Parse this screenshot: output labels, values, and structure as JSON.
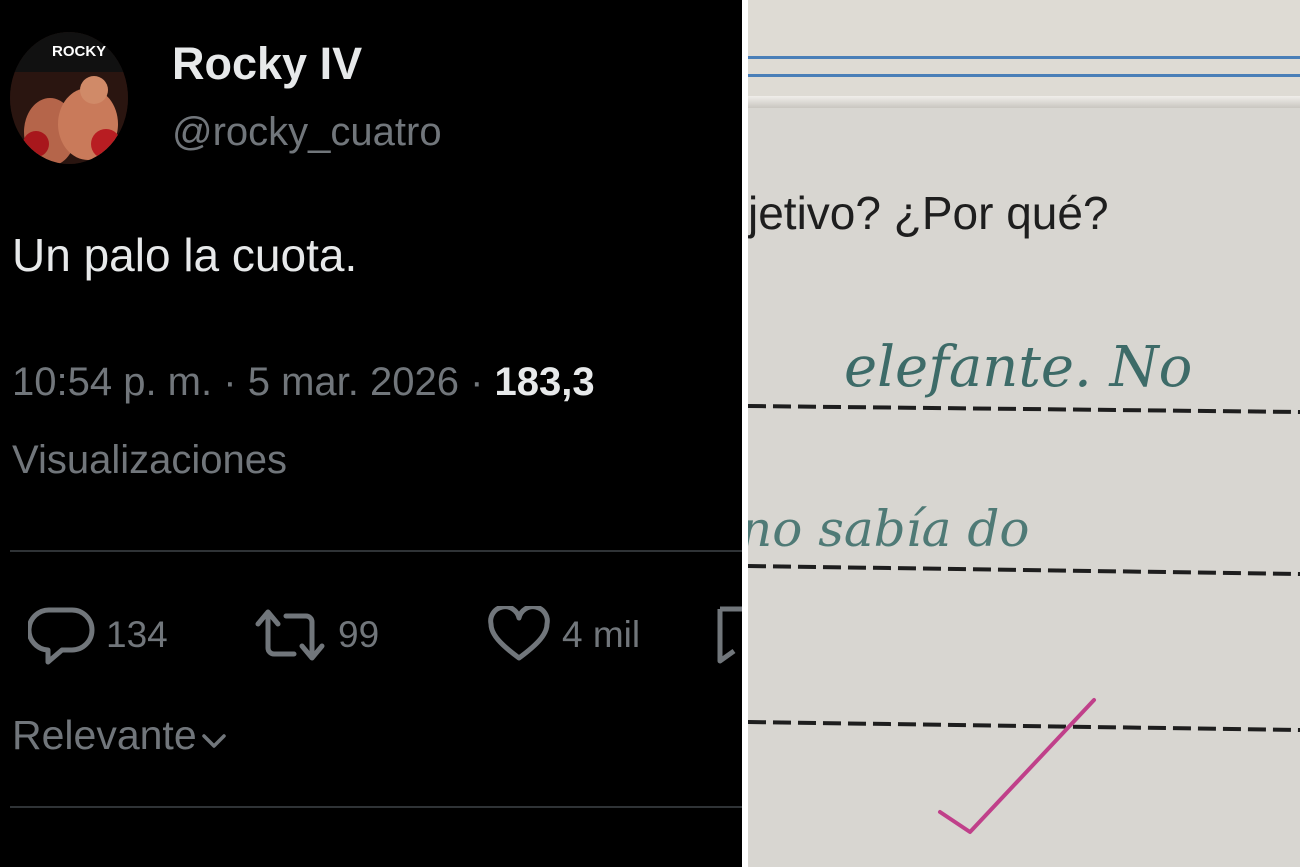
{
  "tweet": {
    "display_name": "Rocky IV",
    "handle": "@rocky_cuatro",
    "avatar_text": "ROCKY",
    "text": "Un palo la cuota.",
    "time": "10:54 p. m.",
    "separator": "·",
    "date": "5 mar. 2026",
    "views_count": "183,3",
    "views_label": "Visualizaciones",
    "actions": {
      "reply": {
        "icon": "reply-icon",
        "count": "134"
      },
      "retweet": {
        "icon": "retweet-icon",
        "count": "99"
      },
      "like": {
        "icon": "heart-icon",
        "count": "4 mil"
      },
      "bookmark": {
        "icon": "bookmark-icon"
      }
    },
    "sort_label": "Relevante",
    "colors": {
      "background": "#000000",
      "primary_text": "#e7e9ea",
      "secondary_text": "#71767b",
      "divider": "#2f3336"
    }
  },
  "notebook": {
    "printed_question": "jetivo? ¿Por qué?",
    "handwritten_line_1": "elefante. No",
    "handwritten_line_2": "no sabía do",
    "check_mark_color": "#c0408a",
    "colors": {
      "paper": "#d8d6d1",
      "rule_blue": "#4a7fb8",
      "handwriting_ink": "#3d6b68"
    }
  }
}
